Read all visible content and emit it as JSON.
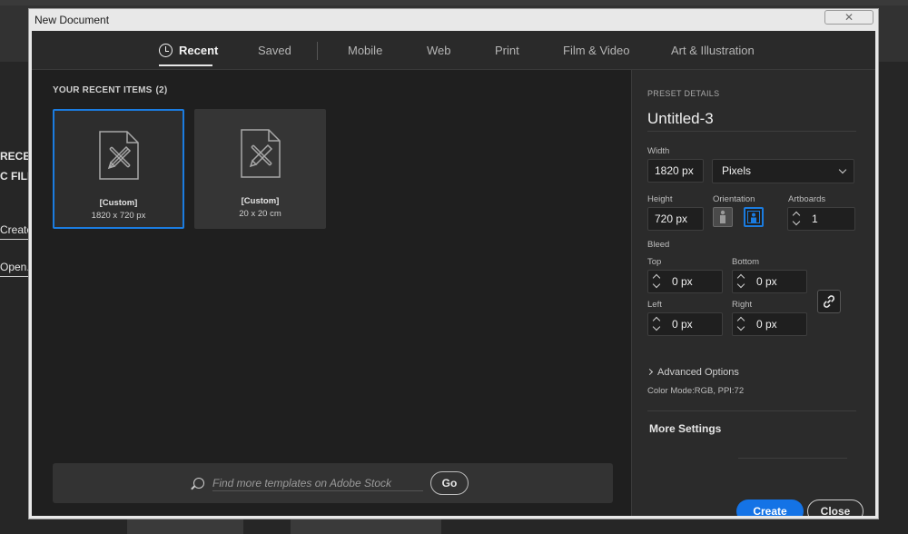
{
  "window": {
    "title": "New Document",
    "close_glyph": "✕"
  },
  "background": {
    "left_labels": [
      "RECENT",
      "C FILE"
    ],
    "left_links": [
      "Create",
      "Open."
    ]
  },
  "tabs": [
    {
      "label": "Recent",
      "active": true,
      "icon": "clock-icon"
    },
    {
      "label": "Saved",
      "active": false
    },
    {
      "label": "Mobile",
      "active": false
    },
    {
      "label": "Web",
      "active": false
    },
    {
      "label": "Print",
      "active": false
    },
    {
      "label": "Film & Video",
      "active": false
    },
    {
      "label": "Art & Illustration",
      "active": false
    }
  ],
  "recent": {
    "title": "YOUR RECENT ITEMS",
    "count": "(2)",
    "items": [
      {
        "name": "[Custom]",
        "size": "1820 x 720 px",
        "selected": true,
        "icon": "document-icon"
      },
      {
        "name": "[Custom]",
        "size": "20 x 20 cm",
        "selected": false,
        "icon": "document-icon"
      }
    ]
  },
  "search": {
    "placeholder": "Find more templates on Adobe Stock",
    "go_label": "Go"
  },
  "preset": {
    "section_title": "PRESET DETAILS",
    "document_name": "Untitled-3",
    "width_label": "Width",
    "width_value": "1820 px",
    "units": "Pixels",
    "height_label": "Height",
    "height_value": "720 px",
    "orientation_label": "Orientation",
    "orientation_selected": "landscape",
    "artboards_label": "Artboards",
    "artboards_value": "1",
    "bleed_label": "Bleed",
    "bleed": {
      "top_label": "Top",
      "top_value": "0 px",
      "bottom_label": "Bottom",
      "bottom_value": "0 px",
      "left_label": "Left",
      "left_value": "0 px",
      "right_label": "Right",
      "right_value": "0 px"
    },
    "advanced_options": "Advanced Options",
    "color_mode": "Color Mode:RGB, PPI:72",
    "more_settings": "More Settings",
    "create_label": "Create",
    "close_label": "Close"
  },
  "colors": {
    "accent": "#1473e6",
    "selection_border": "#1b7ce0",
    "dialog_bg": "#1f1f1f",
    "panel_bg": "#2b2b2b"
  }
}
